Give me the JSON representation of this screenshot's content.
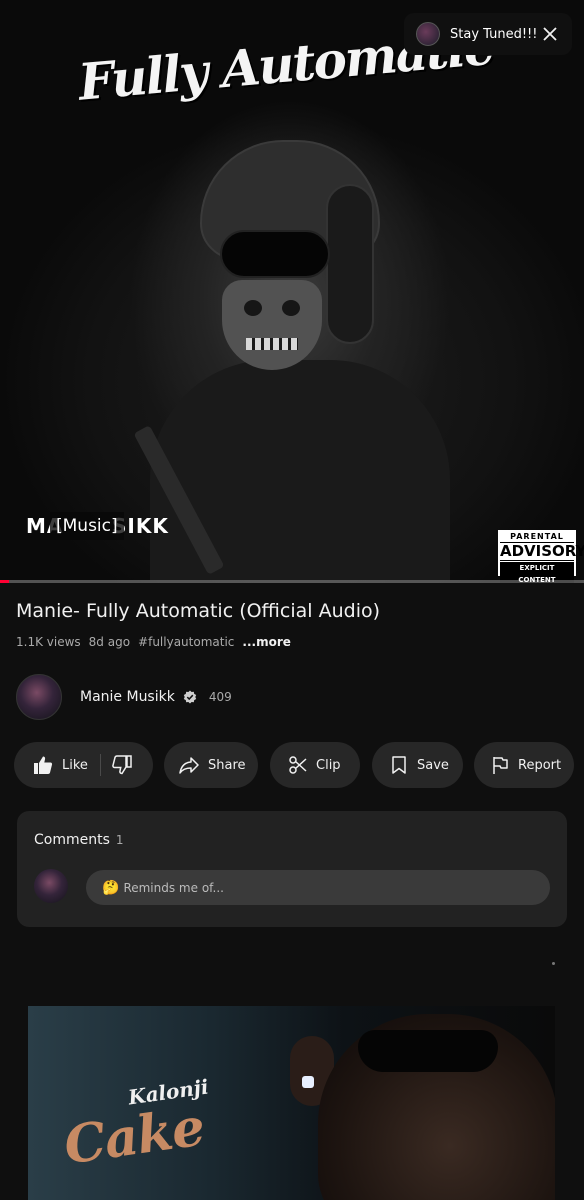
{
  "player": {
    "cover_title": "Fully Automatic",
    "caption": "[Music]",
    "brand_left": "MA",
    "brand_right": "SIKK",
    "advisory": {
      "line1": "PARENTAL",
      "line2": "ADVISORY",
      "line3": "EXPLICIT CONTENT"
    },
    "progress_fraction": 0.015,
    "accent_color": "#ff0033"
  },
  "notification": {
    "label": "Stay Tuned!!!",
    "close_icon": "close-icon"
  },
  "video": {
    "title": "Manie- Fully Automatic (Official Audio)",
    "views": "1.1K views",
    "age": "8d ago",
    "hashtag": "#fullyautomatic",
    "more": "...more"
  },
  "channel": {
    "name": "Manie Musikk",
    "verified_icon": "verified-icon",
    "subscribers": "409"
  },
  "actions": {
    "like": "Like",
    "share": "Share",
    "clip": "Clip",
    "save": "Save",
    "report": "Report"
  },
  "comments": {
    "header": "Comments",
    "count": "1",
    "placeholder_emoji": "🤔",
    "placeholder": "Reminds me of..."
  },
  "next_video": {
    "artist": "Kalonji",
    "title": "Cake"
  }
}
